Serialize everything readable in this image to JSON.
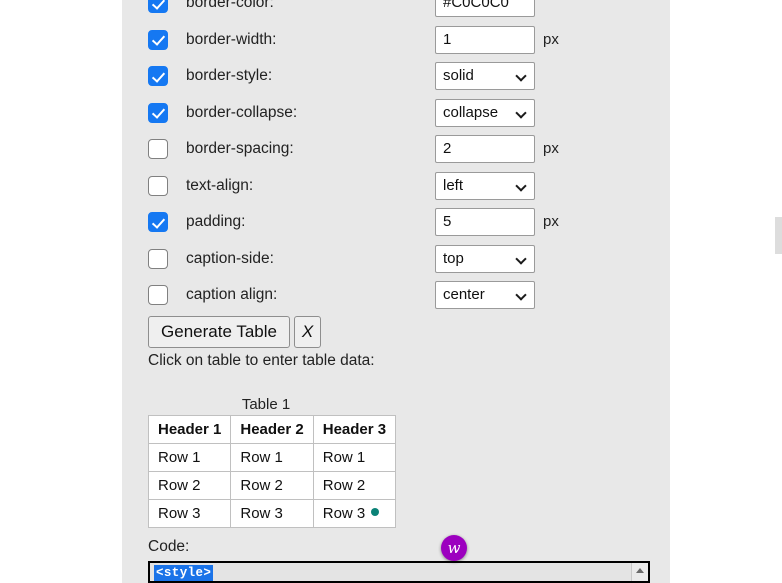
{
  "properties": [
    {
      "name": "border-color",
      "label": "border-color:",
      "checked": true,
      "control": "text",
      "value": "#C0C0C0",
      "unit": "",
      "swatch": "#C0C0C0"
    },
    {
      "name": "border-width",
      "label": "border-width:",
      "checked": true,
      "control": "text",
      "value": "1",
      "unit": "px"
    },
    {
      "name": "border-style",
      "label": "border-style:",
      "checked": true,
      "control": "select",
      "value": "solid",
      "unit": ""
    },
    {
      "name": "border-collapse",
      "label": "border-collapse:",
      "checked": true,
      "control": "select",
      "value": "collapse",
      "unit": ""
    },
    {
      "name": "border-spacing",
      "label": "border-spacing:",
      "checked": false,
      "control": "text",
      "value": "2",
      "unit": "px"
    },
    {
      "name": "text-align",
      "label": "text-align:",
      "checked": false,
      "control": "select",
      "value": "left",
      "unit": ""
    },
    {
      "name": "padding",
      "label": "padding:",
      "checked": true,
      "control": "text",
      "value": "5",
      "unit": "px"
    },
    {
      "name": "caption-side",
      "label": "caption-side:",
      "checked": false,
      "control": "select",
      "value": "top",
      "unit": ""
    },
    {
      "name": "caption align",
      "label": "caption align:",
      "checked": false,
      "control": "select",
      "value": "center",
      "unit": ""
    }
  ],
  "buttons": {
    "generate_label": "Generate Table",
    "clear_label": "X"
  },
  "hint": "Click on table to enter table data:",
  "table": {
    "caption": "Table 1",
    "headers": [
      "Header 1",
      "Header 2",
      "Header 3"
    ],
    "rows": [
      [
        "Row 1",
        "Row 1",
        "Row 1"
      ],
      [
        "Row 2",
        "Row 2",
        "Row 2"
      ],
      [
        "Row 3",
        "Row 3",
        "Row 3"
      ]
    ],
    "marker_color": "#0b8277"
  },
  "code": {
    "label": "Code:",
    "selected_text": "<style>",
    "selection_color": "#1a73e8"
  },
  "overlay": {
    "extension_badge_glyph": "w",
    "extension_badge_color": "#9c00bf"
  },
  "colors": {
    "panel_background": "#e8e8e8",
    "checkbox_checked": "#1578f2"
  }
}
